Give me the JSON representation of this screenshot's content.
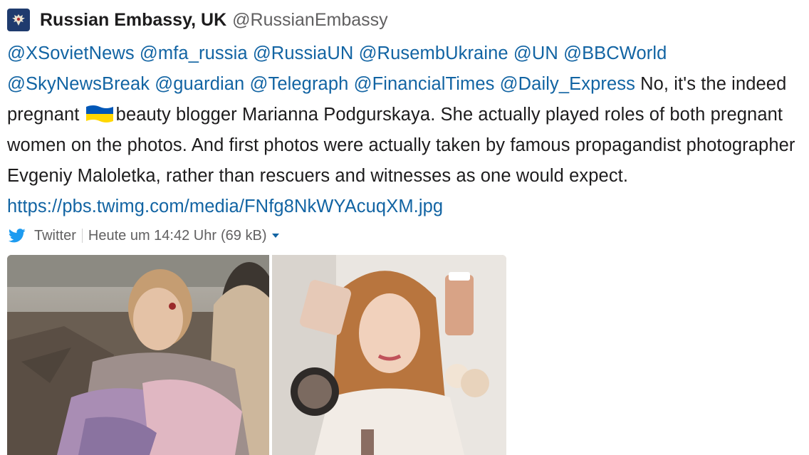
{
  "author": {
    "name": "Russian Embassy, UK",
    "handle": "@RussianEmbassy",
    "avatar_icon": "double-headed-eagle-icon"
  },
  "tweet": {
    "mentions": [
      "@XSovietNews",
      "@mfa_russia",
      "@RussiaUN",
      "@RusembUkraine",
      "@UN",
      "@BBCWorld",
      "@SkyNewsBreak",
      "@guardian",
      "@Telegraph",
      "@FinancialTimes",
      "@Daily_Express"
    ],
    "text_part1": "No, it's the indeed pregnant",
    "text_part2": "beauty blogger Marianna Podgurskaya. She actually played roles of both pregnant women on the photos. And first photos were actually taken by famous propagandist photographer Evgeniy Maloletka, rather than rescuers and witnesses as one would expect.",
    "flag_icon": "ukraine-flag-icon",
    "link": "https://pbs.twimg.com/media/FNfg8NkWYAcuqXM.jpg"
  },
  "meta": {
    "source_icon": "twitter-bird-icon",
    "source": "Twitter",
    "timestamp": "Heute um 14:42 Uhr",
    "size": "(69 kB)",
    "caret_icon": "chevron-down-icon"
  },
  "colors": {
    "link": "#1264a3",
    "twitter_blue": "#1d9bf0",
    "flag_blue": "#0057b7",
    "flag_yellow": "#ffd700"
  }
}
